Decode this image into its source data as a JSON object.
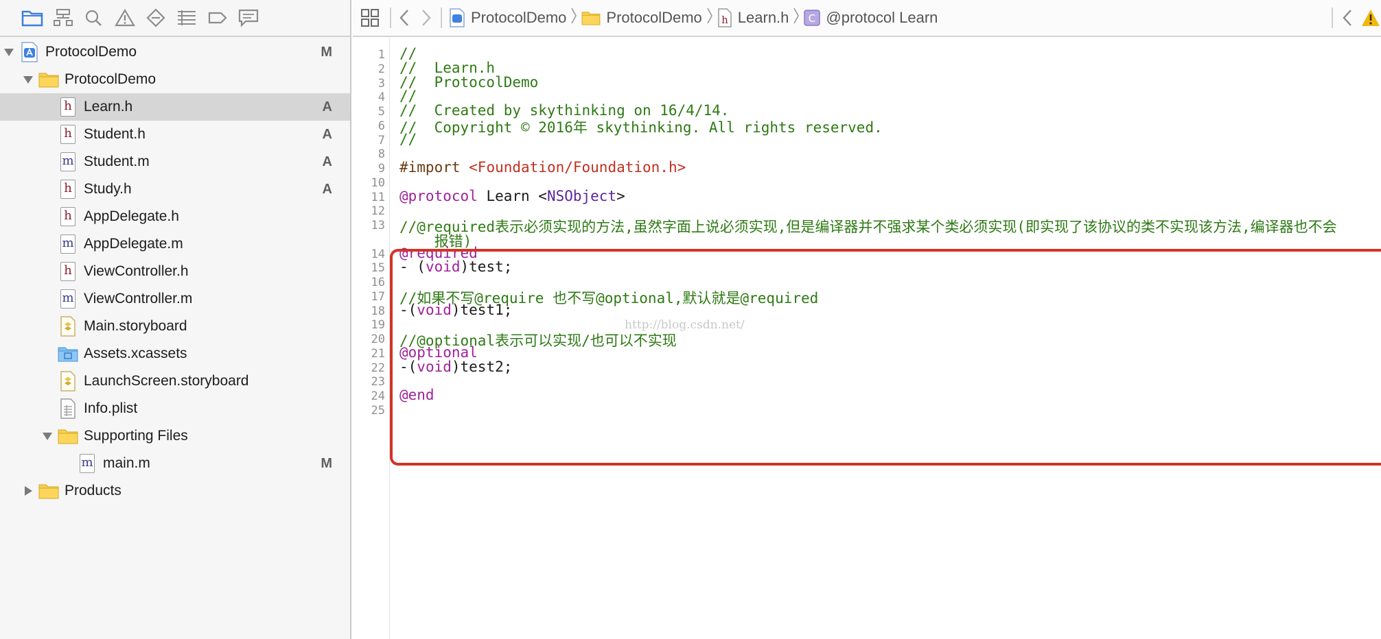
{
  "navigator": {
    "toolbar_icons": [
      "folder-icon",
      "hierarchy-icon",
      "search-icon",
      "warning-icon",
      "test-diamond-icon",
      "list-icon",
      "tag-icon",
      "message-icon"
    ],
    "items": [
      {
        "name": "ProtocolDemo",
        "kind": "project",
        "level": 0,
        "expanded": true,
        "status": "M"
      },
      {
        "name": "ProtocolDemo",
        "kind": "folder",
        "level": 1,
        "expanded": true,
        "status": ""
      },
      {
        "name": "Learn.h",
        "kind": "h",
        "level": 2,
        "status": "A",
        "selected": true
      },
      {
        "name": "Student.h",
        "kind": "h",
        "level": 2,
        "status": "A"
      },
      {
        "name": "Student.m",
        "kind": "m",
        "level": 2,
        "status": "A"
      },
      {
        "name": "Study.h",
        "kind": "h",
        "level": 2,
        "status": "A"
      },
      {
        "name": "AppDelegate.h",
        "kind": "h",
        "level": 2,
        "status": ""
      },
      {
        "name": "AppDelegate.m",
        "kind": "m",
        "level": 2,
        "status": ""
      },
      {
        "name": "ViewController.h",
        "kind": "h",
        "level": 2,
        "status": ""
      },
      {
        "name": "ViewController.m",
        "kind": "m",
        "level": 2,
        "status": ""
      },
      {
        "name": "Main.storyboard",
        "kind": "storyboard",
        "level": 2,
        "status": ""
      },
      {
        "name": "Assets.xcassets",
        "kind": "assets",
        "level": 2,
        "status": ""
      },
      {
        "name": "LaunchScreen.storyboard",
        "kind": "storyboard",
        "level": 2,
        "status": ""
      },
      {
        "name": "Info.plist",
        "kind": "plist",
        "level": 2,
        "status": ""
      },
      {
        "name": "Supporting Files",
        "kind": "folder",
        "level": 2,
        "expanded": true,
        "status": ""
      },
      {
        "name": "main.m",
        "kind": "m",
        "level": 3,
        "status": "M"
      },
      {
        "name": "Products",
        "kind": "folder",
        "level": 1,
        "expanded": false,
        "status": ""
      }
    ]
  },
  "jumpbar": {
    "crumbs": [
      {
        "label": "ProtocolDemo",
        "icon": "project-icon"
      },
      {
        "label": "ProtocolDemo",
        "icon": "folder-icon"
      },
      {
        "label": "Learn.h",
        "icon": "header-file-icon"
      },
      {
        "label": "@protocol Learn",
        "icon": "protocol-icon"
      }
    ]
  },
  "editor": {
    "line_numbers": [
      "1",
      "2",
      "3",
      "4",
      "5",
      "6",
      "7",
      "8",
      "9",
      "10",
      "11",
      "12",
      "13",
      "14",
      "15",
      "16",
      "17",
      "18",
      "19",
      "20",
      "21",
      "22",
      "23",
      "24",
      "25"
    ],
    "lines": [
      [
        {
          "t": "//",
          "c": "cm"
        }
      ],
      [
        {
          "t": "//  Learn.h",
          "c": "cm"
        }
      ],
      [
        {
          "t": "//  ProtocolDemo",
          "c": "cm"
        }
      ],
      [
        {
          "t": "//",
          "c": "cm"
        }
      ],
      [
        {
          "t": "//  Created by skythinking on 16/4/14.",
          "c": "cm"
        }
      ],
      [
        {
          "t": "//  Copyright © 2016年 skythinking. All rights reserved.",
          "c": "cm"
        }
      ],
      [
        {
          "t": "//",
          "c": "cm"
        }
      ],
      [],
      [
        {
          "t": "#import ",
          "c": "pp"
        },
        {
          "t": "<Foundation/Foundation.h>",
          "c": "str"
        }
      ],
      [],
      [
        {
          "t": "@protocol",
          "c": "kw"
        },
        {
          "t": " Learn <",
          "c": "plain"
        },
        {
          "t": "NSObject",
          "c": "typ"
        },
        {
          "t": ">",
          "c": "plain"
        }
      ],
      [],
      [
        {
          "t": "//@required表示必须实现的方法,虽然字面上说必须实现,但是编译器并不强求某个类必须实现(即实现了该协议的类不实现该方法,编译器也不会",
          "c": "cm"
        }
      ],
      [
        {
          "t": "    报错)",
          "c": "cm"
        }
      ],
      [
        {
          "t": "@required",
          "c": "kw"
        }
      ],
      [
        {
          "t": "- (",
          "c": "plain"
        },
        {
          "t": "void",
          "c": "kw"
        },
        {
          "t": ")test;",
          "c": "plain"
        }
      ],
      [],
      [
        {
          "t": "//如果不写@require 也不写@optional,默认就是@required",
          "c": "cm"
        }
      ],
      [
        {
          "t": "-(",
          "c": "plain"
        },
        {
          "t": "void",
          "c": "kw"
        },
        {
          "t": ")test1;",
          "c": "plain"
        }
      ],
      [],
      [
        {
          "t": "//@optional表示可以实现/也可以不实现",
          "c": "cm"
        }
      ],
      [
        {
          "t": "@optional",
          "c": "kw"
        }
      ],
      [
        {
          "t": "-(",
          "c": "plain"
        },
        {
          "t": "void",
          "c": "kw"
        },
        {
          "t": ")test2;",
          "c": "plain"
        }
      ],
      [],
      [
        {
          "t": "@end",
          "c": "kw"
        }
      ],
      []
    ],
    "watermark": "http://blog.csdn.net/"
  },
  "colors": {
    "comment": "#2e7a14",
    "keyword": "#a0219c",
    "string": "#c0311f",
    "highlight_box": "#d23326",
    "selection": "#d6d6d6"
  }
}
